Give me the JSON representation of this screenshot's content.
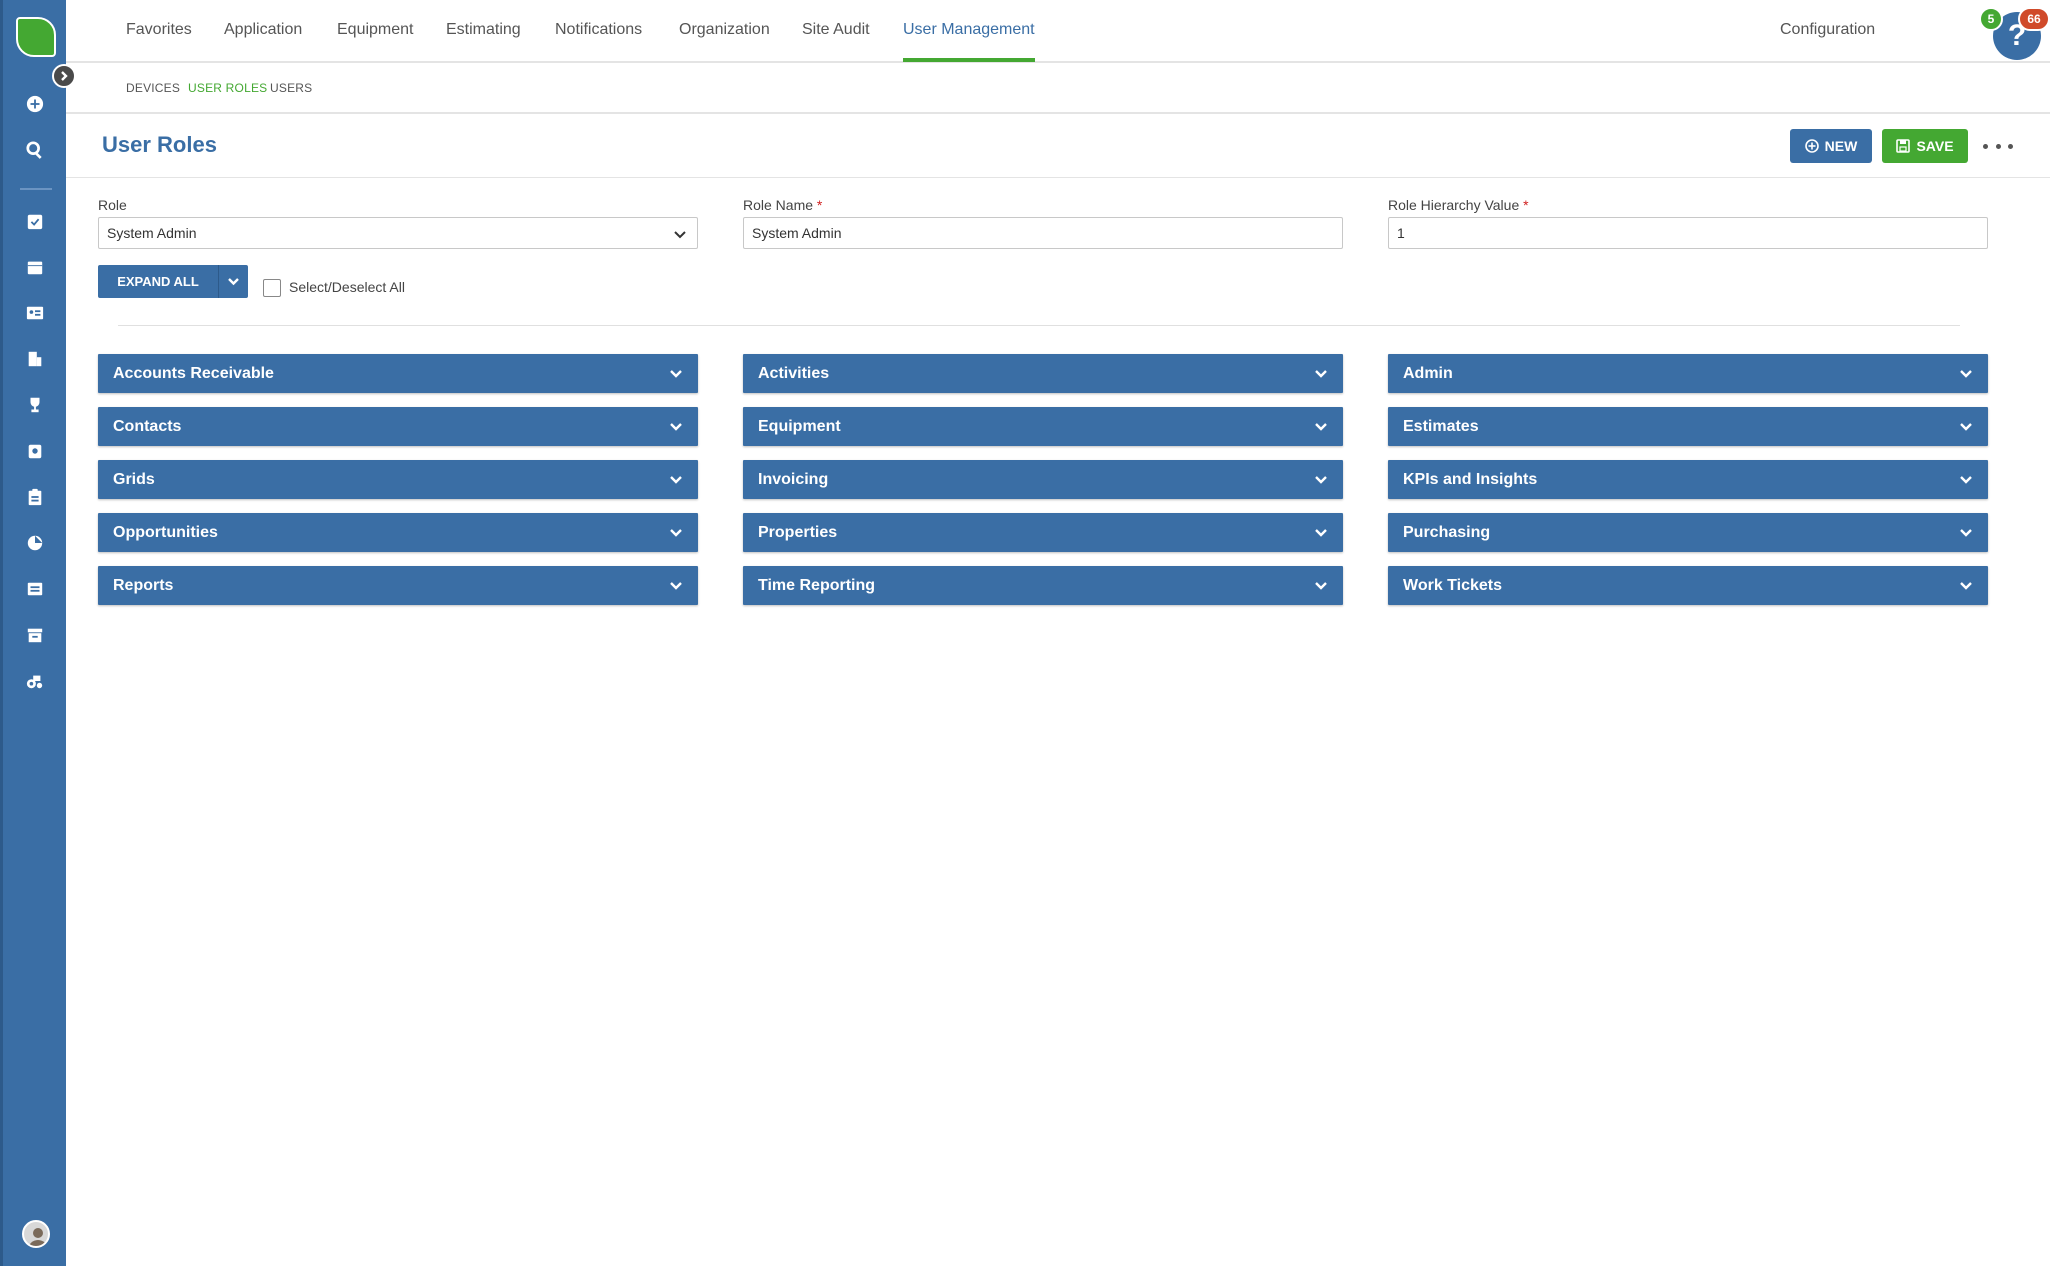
{
  "nav": {
    "tabs": [
      {
        "label": "Favorites"
      },
      {
        "label": "Application"
      },
      {
        "label": "Equipment"
      },
      {
        "label": "Estimating"
      },
      {
        "label": "Notifications"
      },
      {
        "label": "Organization"
      },
      {
        "label": "Site Audit"
      },
      {
        "label": "User Management"
      }
    ],
    "active_tab": "User Management",
    "configuration": "Configuration",
    "badges": {
      "green": "5",
      "red": "66"
    },
    "help_label": "?"
  },
  "subtabs": [
    {
      "label": "DEVICES"
    },
    {
      "label": "USER ROLES"
    },
    {
      "label": "USERS"
    }
  ],
  "active_subtab": "USER ROLES",
  "page": {
    "title": "User Roles",
    "new_label": "NEW",
    "save_label": "SAVE"
  },
  "form": {
    "role_label": "Role",
    "role_value": "System Admin",
    "role_name_label": "Role Name",
    "role_name_value": "System Admin",
    "hierarchy_label": "Role Hierarchy Value",
    "hierarchy_value": "1",
    "required_mark": "*",
    "expand_all_label": "EXPAND ALL",
    "select_all_label": "Select/Deselect All"
  },
  "panels": [
    {
      "label": "Accounts Receivable"
    },
    {
      "label": "Activities"
    },
    {
      "label": "Admin"
    },
    {
      "label": "Contacts"
    },
    {
      "label": "Equipment"
    },
    {
      "label": "Estimates"
    },
    {
      "label": "Grids"
    },
    {
      "label": "Invoicing"
    },
    {
      "label": "KPIs and Insights"
    },
    {
      "label": "Opportunities"
    },
    {
      "label": "Properties"
    },
    {
      "label": "Purchasing"
    },
    {
      "label": "Reports"
    },
    {
      "label": "Time Reporting"
    },
    {
      "label": "Work Tickets"
    }
  ],
  "colors": {
    "primary": "#3a6ea5",
    "accent": "#44a832",
    "danger": "#d04a2a"
  }
}
